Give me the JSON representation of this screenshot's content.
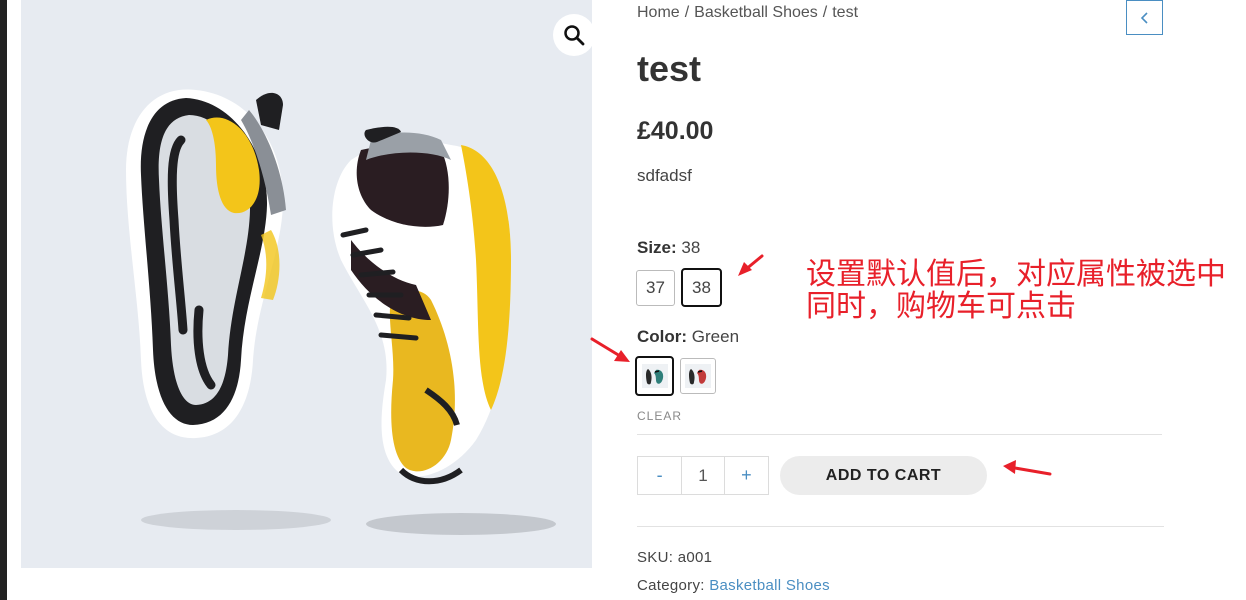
{
  "breadcrumb": {
    "home": "Home",
    "category": "Basketball Shoes",
    "current": "test",
    "separator": "/"
  },
  "product": {
    "title": "test",
    "price": "£40.00",
    "short_description": "sdfadsf",
    "image_alt": "Pair of yellow and white running shoes"
  },
  "size": {
    "label": "Size",
    "selected": "38",
    "options": [
      "37",
      "38"
    ]
  },
  "color": {
    "label": "Color",
    "selected": "Green",
    "options": [
      "Green",
      "Red"
    ]
  },
  "clear_label": "CLEAR",
  "quantity": {
    "value": "1",
    "minus": "-",
    "plus": "+"
  },
  "add_to_cart_label": "ADD TO CART",
  "meta": {
    "sku_label": "SKU:",
    "sku": "a001",
    "category_label": "Category:",
    "category": "Basketball Shoes"
  },
  "annotation": {
    "line1": "设置默认值后，对应属性被选中",
    "line2": "同时，购物车可点击",
    "color": "#e8202a"
  },
  "icons": {
    "zoom": "magnifier-icon",
    "prev": "chevron-left-icon"
  },
  "colors": {
    "accent": "#4a8ec2",
    "selected_border": "#111111",
    "image_bg": "#e7ebf1"
  }
}
